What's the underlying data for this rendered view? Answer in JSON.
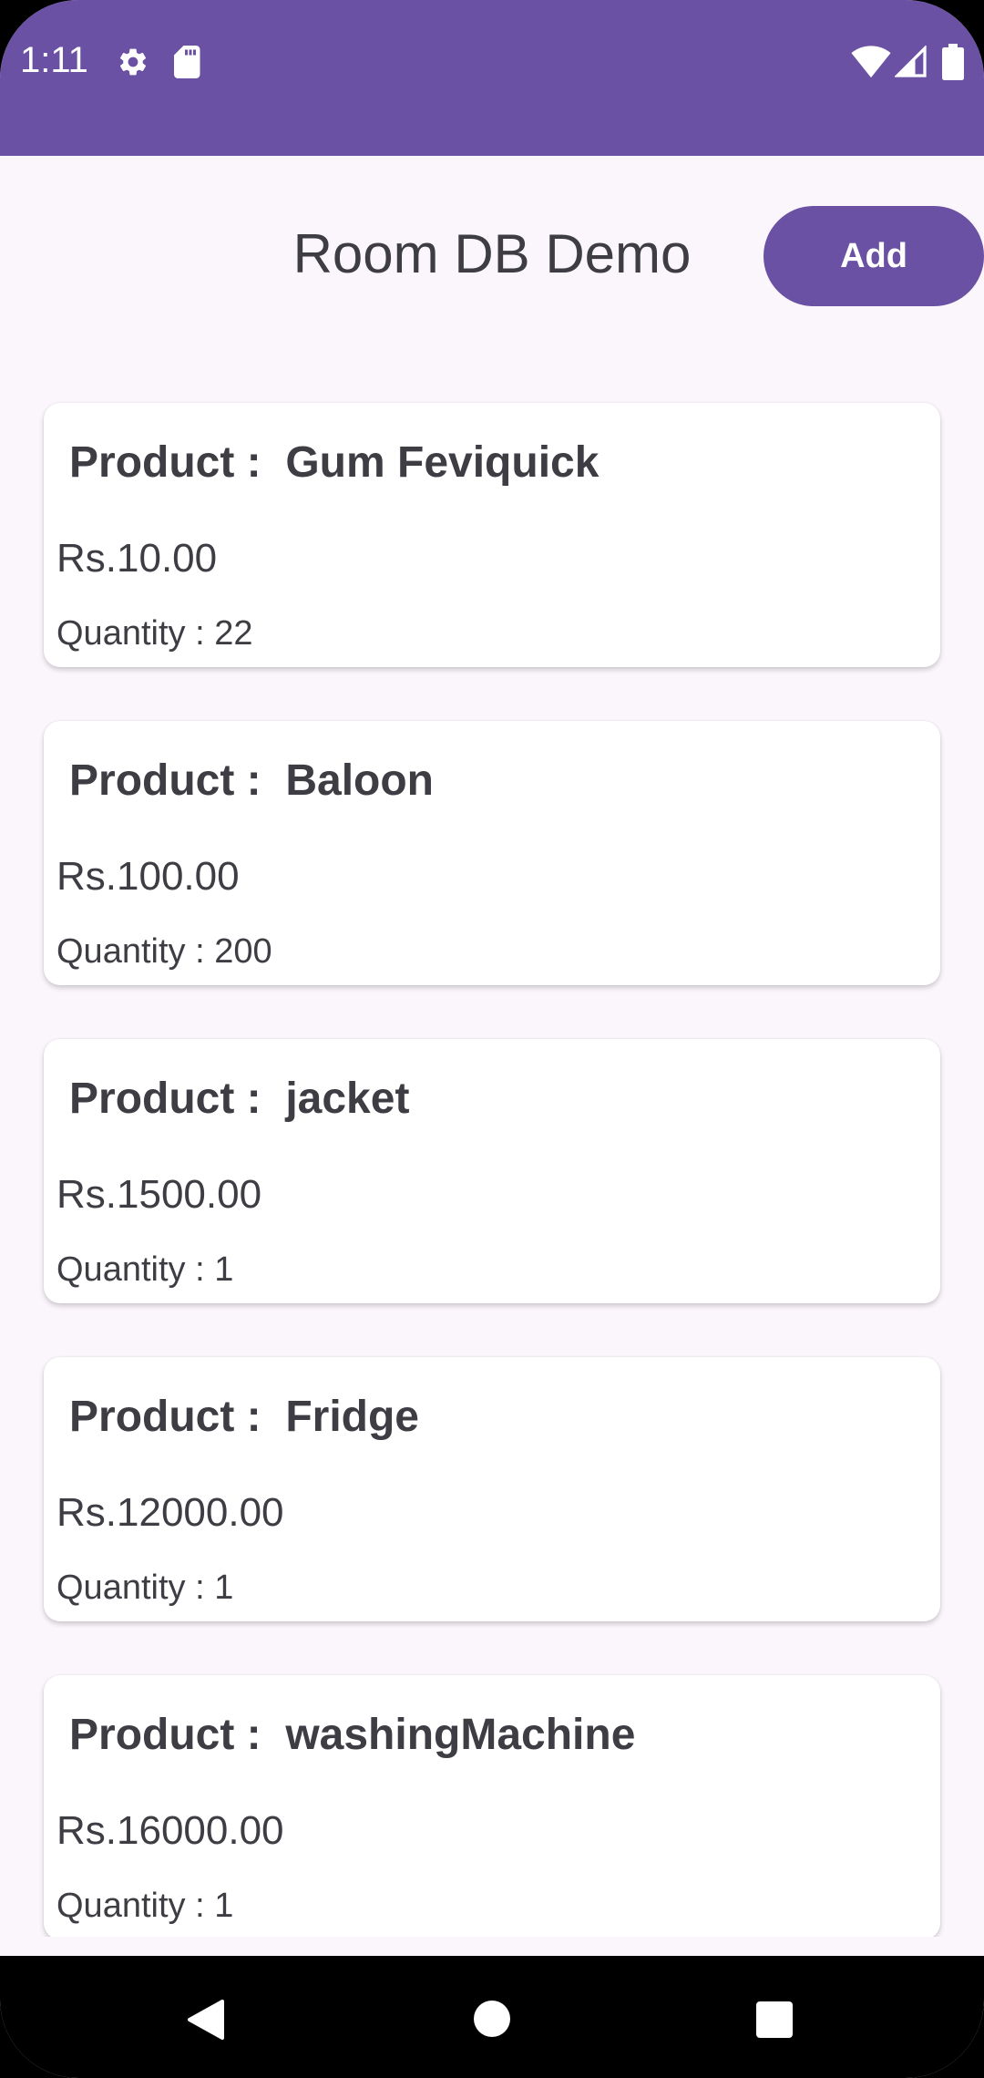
{
  "status_bar": {
    "time": "1:11",
    "icons": [
      "gear-icon",
      "sdcard-icon",
      "wifi-icon",
      "signal-icon",
      "battery-icon"
    ],
    "color": "#6a51a3"
  },
  "header": {
    "title": "Room DB Demo",
    "add_label": "Add"
  },
  "products": [
    {
      "name": "Product :  Gum Feviquick",
      "price": "Rs.10.00",
      "quantity": "Quantity : 22"
    },
    {
      "name": "Product :  Baloon",
      "price": "Rs.100.00",
      "quantity": "Quantity : 200"
    },
    {
      "name": "Product :  jacket",
      "price": "Rs.1500.00",
      "quantity": "Quantity : 1"
    },
    {
      "name": "Product :  Fridge",
      "price": "Rs.12000.00",
      "quantity": "Quantity : 1"
    },
    {
      "name": "Product :  washingMachine",
      "price": "Rs.16000.00",
      "quantity": "Quantity : 1"
    }
  ],
  "nav_bar": {
    "icons": [
      "back-icon",
      "home-icon",
      "recents-icon"
    ]
  },
  "colors": {
    "accent": "#6a51a3",
    "background": "#fbf6fc",
    "text": "#3e3d44"
  }
}
